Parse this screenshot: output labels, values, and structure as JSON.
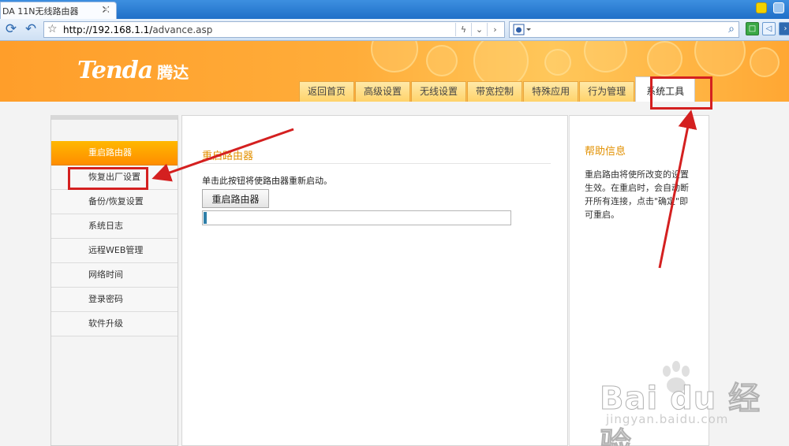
{
  "browser": {
    "tab_title": "DA 11N无线路由器",
    "tab_close": "✕",
    "new_tab": "+",
    "url_host": "http://192.168.1.1/",
    "url_path": "advance.asp"
  },
  "brand": {
    "logo_en": "Tenda",
    "logo_cn": "腾达"
  },
  "top_nav": [
    {
      "label": "返回首页"
    },
    {
      "label": "高级设置"
    },
    {
      "label": "无线设置"
    },
    {
      "label": "带宽控制"
    },
    {
      "label": "特殊应用"
    },
    {
      "label": "行为管理"
    },
    {
      "label": "系统工具"
    }
  ],
  "side_menu": [
    {
      "label": "重启路由器",
      "active": true
    },
    {
      "label": "恢复出厂设置"
    },
    {
      "label": "备份/恢复设置"
    },
    {
      "label": "系统日志"
    },
    {
      "label": "远程WEB管理"
    },
    {
      "label": "网络时间"
    },
    {
      "label": "登录密码"
    },
    {
      "label": "软件升级"
    }
  ],
  "main": {
    "title": "重启路由器",
    "description": "单击此按钮将使路由器重新启动。",
    "button_label": "重启路由器",
    "progress": 0.01
  },
  "help": {
    "title": "帮助信息",
    "text": "重启路由将使所改变的设置生效。在重启时，会自动断开所有连接，点击\"确定\"即可重启。"
  },
  "watermark": {
    "brand": "Bai du 经验",
    "url": "jingyan.baidu.com"
  },
  "colors": {
    "header_orange": "#ffa733",
    "menu_active": "#ff9a00",
    "title_accent": "#e29000",
    "annotation_red": "#d42020",
    "progress_fill": "#2f7fa8"
  }
}
